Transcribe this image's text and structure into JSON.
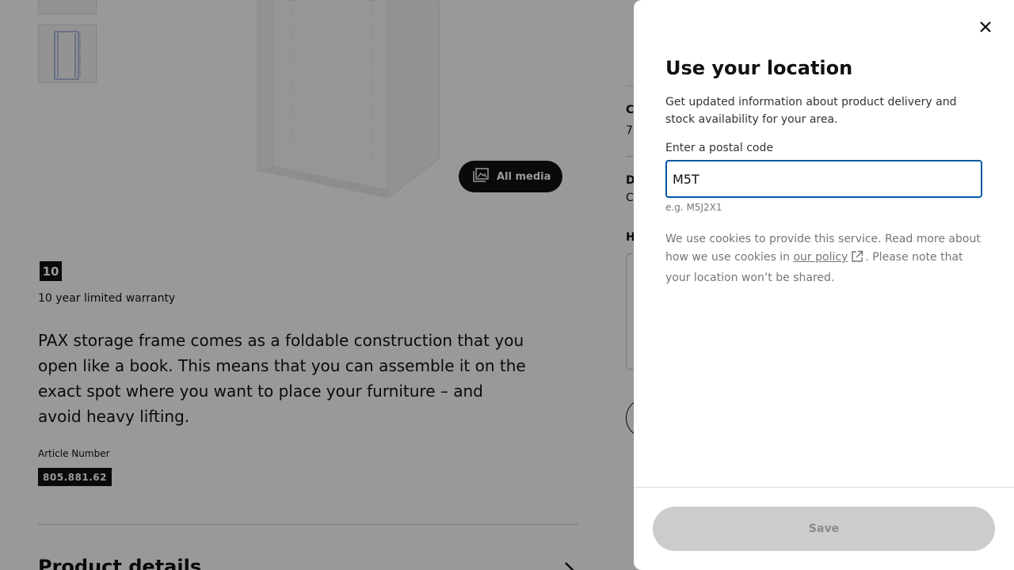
{
  "background": {
    "all_media_label": "All media",
    "warranty_badge": "10",
    "warranty_text": "10 year limited warranty",
    "description": "PAX storage frame comes as a foldable construction that you open like a book. This means that you can assemble it on the exact spot where you want to place your furniture – and avoid heavy lifting.",
    "article_label": "Article Number",
    "article_number": "805.881.62",
    "product_details_heading": "Product details",
    "right_col": {
      "c_initial": "C",
      "seven": "7",
      "d_initial": "D",
      "c2_initial": "C",
      "h_initial": "H"
    }
  },
  "modal": {
    "title": "Use your location",
    "description": "Get updated information about product delivery and stock availability for your area.",
    "postal_label": "Enter a postal code",
    "postal_value": "M5T",
    "postal_hint": "e.g. M5J2X1",
    "cookie_text_before": "We use cookies to provide this service. Read more about how we use cookies in ",
    "cookie_link": "our policy",
    "cookie_text_after": ". Please note that your location won’t be shared.",
    "save_label": "Save"
  },
  "colors": {
    "focus_border": "#0058a3",
    "overlay": "rgba(0,0,0,0.4)",
    "save_disabled_bg": "#cccccc"
  }
}
